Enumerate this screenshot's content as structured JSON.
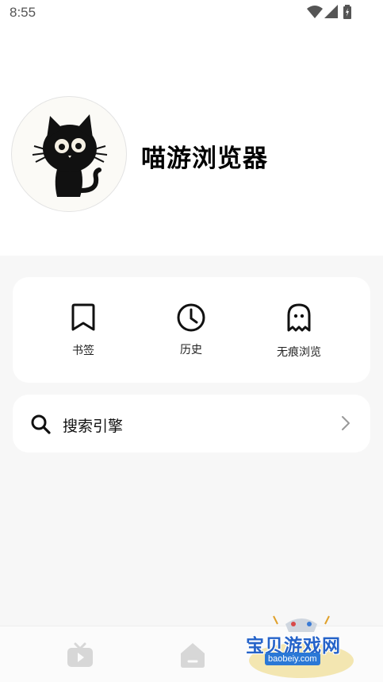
{
  "status_bar": {
    "time": "8:55",
    "icons": [
      "wifi-icon",
      "signal-icon",
      "battery-icon"
    ]
  },
  "profile": {
    "avatar": "black-cat-avatar",
    "app_name": "喵游浏览器"
  },
  "quick_actions": [
    {
      "label": "书签",
      "icon": "bookmark-icon"
    },
    {
      "label": "历史",
      "icon": "clock-icon"
    },
    {
      "label": "无痕浏览",
      "icon": "ghost-icon"
    }
  ],
  "settings": {
    "search_engine_label": "搜索引擎",
    "search_icon": "search-icon",
    "chevron_icon": "chevron-right-icon"
  },
  "bottom_nav": {
    "items": [
      "tv-icon",
      "home-icon"
    ]
  },
  "watermark": {
    "title": "宝贝游戏网",
    "url": "baobeiy.com"
  },
  "colors": {
    "background": "#f7f7f7",
    "card": "#ffffff",
    "text": "#111111",
    "nav_icon": "#d7d7d7",
    "watermark_blue": "#2563c9"
  }
}
